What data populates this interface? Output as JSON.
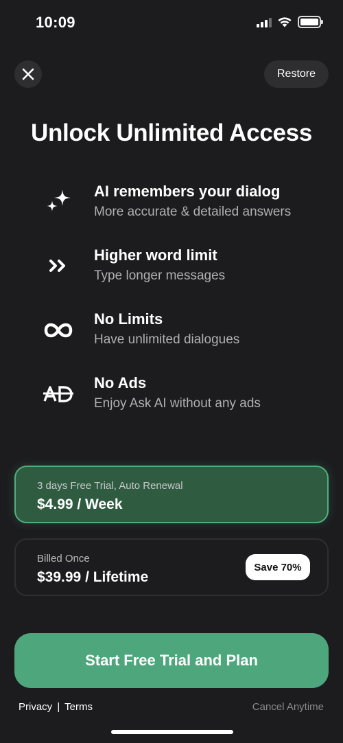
{
  "status_bar": {
    "time": "10:09",
    "icons": [
      "cellular-signal-icon",
      "wifi-icon",
      "battery-icon"
    ]
  },
  "header": {
    "close_icon": "close-icon",
    "restore_label": "Restore"
  },
  "title": "Unlock Unlimited Access",
  "features": [
    {
      "icon": "sparkles-icon",
      "title": "AI remembers your dialog",
      "subtitle": "More accurate & detailed answers"
    },
    {
      "icon": "double-chevron-right-icon",
      "title": "Higher word limit",
      "subtitle": "Type longer messages"
    },
    {
      "icon": "infinity-icon",
      "title": "No Limits",
      "subtitle": "Have unlimited dialogues"
    },
    {
      "icon": "no-ads-icon",
      "title": "No Ads",
      "subtitle": "Enjoy Ask AI without any ads"
    }
  ],
  "plans": [
    {
      "subtitle": "3 days Free Trial, Auto Renewal",
      "price": "$4.99 / Week",
      "selected": true
    },
    {
      "subtitle": "Billed Once",
      "price": "$39.99 / Lifetime",
      "badge": "Save 70%",
      "selected": false
    }
  ],
  "cta_label": "Start Free Trial and Plan",
  "footer": {
    "privacy": "Privacy",
    "separator": "|",
    "terms": "Terms",
    "cancel": "Cancel Anytime"
  },
  "colors": {
    "background": "#1c1c1e",
    "accent": "#4ea77c",
    "selected_plan_bg": "#2f5c41",
    "selected_plan_border": "#4fb07f"
  }
}
